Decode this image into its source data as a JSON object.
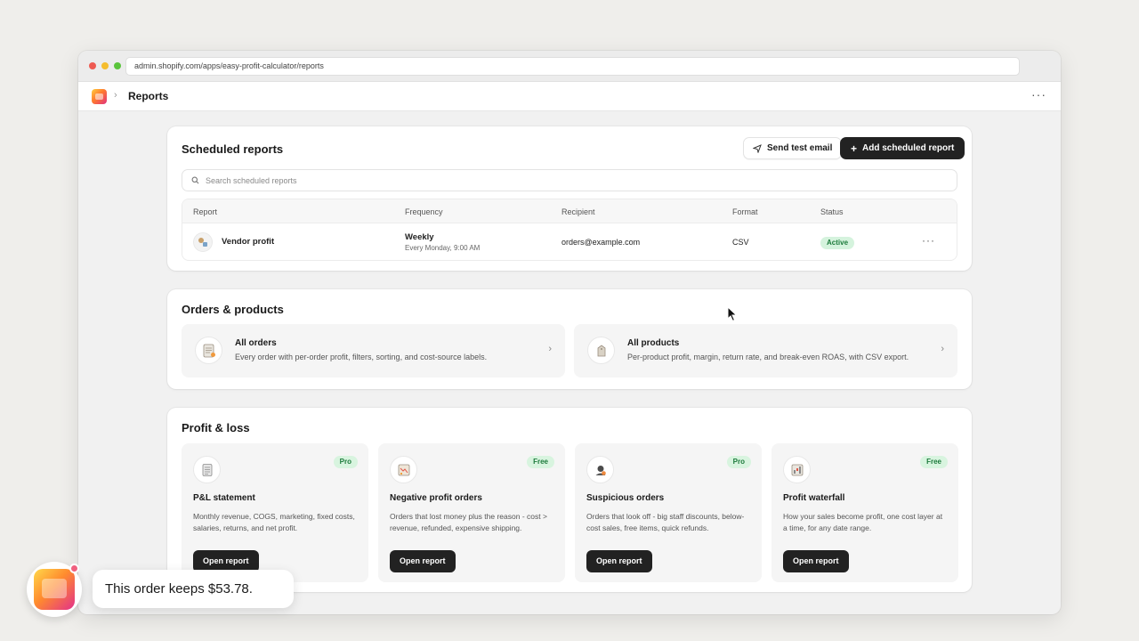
{
  "browser": {
    "url": "admin.shopify.com/apps/easy-profit-calculator/reports"
  },
  "appbar": {
    "breadcrumb_sep": "›",
    "title": "Reports",
    "more": "···"
  },
  "scheduled": {
    "title": "Scheduled reports",
    "send_test_label": "Send test email",
    "add_label": "Add scheduled report",
    "search_placeholder": "Search scheduled reports",
    "columns": [
      "Report",
      "Frequency",
      "Recipient",
      "Format",
      "Status"
    ],
    "rows": [
      {
        "report": "Vendor profit",
        "frequency": "Weekly",
        "frequency_detail": "Every Monday, 9:00 AM",
        "recipient": "orders@example.com",
        "format": "CSV",
        "status": "Active",
        "more": "···"
      }
    ]
  },
  "orders_products": {
    "title": "Orders & products",
    "tiles": [
      {
        "title": "All orders",
        "desc": "Every order with per-order profit, filters, sorting, and cost-source labels.",
        "icon": "orders-icon"
      },
      {
        "title": "All products",
        "desc": "Per-product profit, margin, return rate, and break-even ROAS, with CSV export.",
        "icon": "products-icon"
      }
    ]
  },
  "profit_loss": {
    "title": "Profit & loss",
    "cards": [
      {
        "badge": "Pro",
        "title": "P&L statement",
        "desc": "Monthly revenue, COGS, marketing, fixed costs, salaries, returns, and net profit.",
        "button": "Open report",
        "icon": "document-icon"
      },
      {
        "badge": "Free",
        "title": "Negative profit orders",
        "desc": "Orders that lost money plus the reason - cost > revenue, refunded, expensive shipping.",
        "button": "Open report",
        "icon": "chart-down-icon"
      },
      {
        "badge": "Pro",
        "title": "Suspicious orders",
        "desc": "Orders that look off - big staff discounts, below-cost sales, free items, quick refunds.",
        "button": "Open report",
        "icon": "spy-icon"
      },
      {
        "badge": "Free",
        "title": "Profit waterfall",
        "desc": "How your sales become profit, one cost layer at a time, for any date range.",
        "button": "Open report",
        "icon": "waterfall-icon"
      }
    ]
  },
  "toast": {
    "message": "This order keeps $53.78."
  },
  "colors": {
    "accent_dark": "#222222",
    "badge_green_bg": "#d8f4df",
    "badge_green_text": "#1d7b3c",
    "notification": "#f0607f"
  }
}
